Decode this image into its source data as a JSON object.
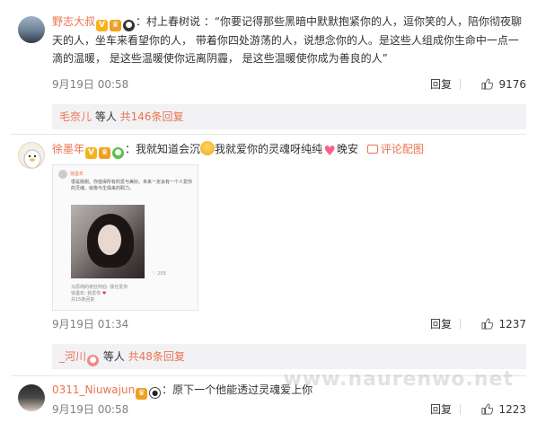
{
  "comments": [
    {
      "user": "野志大叔",
      "text": "：村上春树说 ：“你要记得那些黑暗中默默抱紧你的人，逗你笑的人，陪你彻夜聊天的人，坐车来看望你的人， 带着你四处游荡的人，说想念你的人。是这些人组成你生命中一点一滴的温暖， 是这些温暖使你远离阴霾， 是这些温暖使你成为善良的人”",
      "time": "9月19日 00:58",
      "reply": "回复",
      "likes": "9176",
      "sub": {
        "user": "毛奈儿",
        "text": " 等人 ",
        "count": "共146条回复"
      }
    },
    {
      "user": "徐墨年",
      "text_a": "：我就知道会沉",
      "text_b": "我就爱你的灵魂呀纯纯",
      "text_c": "晚安",
      "pic_link": "评论配图",
      "time": "9月19日 01:34",
      "reply": "回复",
      "likes": "1237",
      "sub": {
        "user": "_河川",
        "text": " 等人 ",
        "count": "共48条回复"
      }
    },
    {
      "user": "0311_Niuwajun",
      "text": "：原下一个他能透过灵魂爱上你",
      "time": "9月19日 00:58",
      "reply": "回复",
      "likes": "1223"
    }
  ],
  "screenshot": {
    "user": "徐墨年",
    "text": "很是挑剔。你值得所有的爱与美好。未来一定会有一个人爱你的灵魂，就像与生俱来的羁力。",
    "likes": "258",
    "quoted": "马思纯的谢丝阿后: 我也爱你",
    "reply_line": "徐墨年: 我爱你",
    "more": "共15条回复"
  },
  "watermark": "www.naurenwo.net",
  "colors": {
    "accent": "#eb7350",
    "subbox": "#f2f2f5",
    "meta": "#808080"
  }
}
